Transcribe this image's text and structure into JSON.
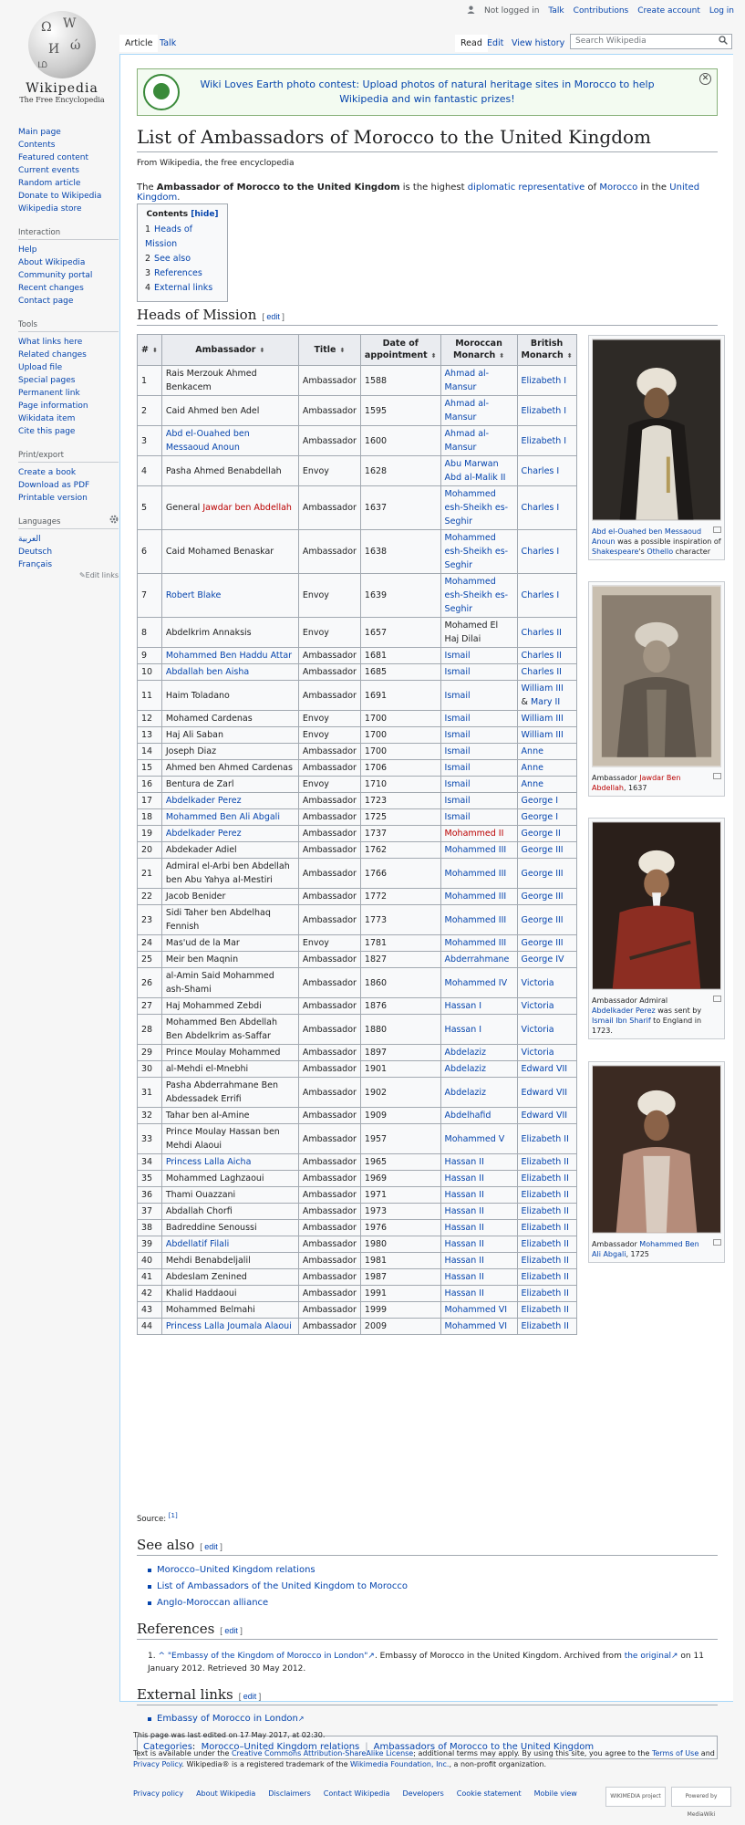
{
  "personal": {
    "not_logged_in": "Not logged in",
    "talk": "Talk",
    "contributions": "Contributions",
    "create_account": "Create account",
    "log_in": "Log in"
  },
  "logo": {
    "wordmark": "Wikipedia",
    "tagline": "The Free Encyclopedia"
  },
  "nav_main": [
    "Main page",
    "Contents",
    "Featured content",
    "Current events",
    "Random article",
    "Donate to Wikipedia",
    "Wikipedia store"
  ],
  "interaction": {
    "heading": "Interaction",
    "items": [
      "Help",
      "About Wikipedia",
      "Community portal",
      "Recent changes",
      "Contact page"
    ]
  },
  "tools": {
    "heading": "Tools",
    "items": [
      "What links here",
      "Related changes",
      "Upload file",
      "Special pages",
      "Permanent link",
      "Page information",
      "Wikidata item",
      "Cite this page"
    ]
  },
  "printexport": {
    "heading": "Print/export",
    "items": [
      "Create a book",
      "Download as PDF",
      "Printable version"
    ]
  },
  "languages": {
    "heading": "Languages",
    "items": [
      "العربية",
      "Deutsch",
      "Français"
    ],
    "edit_links": "Edit links"
  },
  "tabs": {
    "article": "Article",
    "talk": "Talk",
    "read": "Read",
    "edit": "Edit",
    "history": "View history"
  },
  "search": {
    "placeholder": "Search Wikipedia"
  },
  "banner": {
    "text": "Wiki Loves Earth photo contest: Upload photos of natural heritage sites in Morocco to help Wikipedia and win fantastic prizes!"
  },
  "article": {
    "title": "List of Ambassadors of Morocco to the United Kingdom",
    "from": "From Wikipedia, the free encyclopedia",
    "lead": {
      "p1": "The ",
      "bold": "Ambassador of Morocco to the United Kingdom",
      "p2": " is the highest ",
      "l1": "diplomatic representative",
      "p3": " of ",
      "l2": "Morocco",
      "p4": " in the ",
      "l3": "United Kingdom",
      "p5": "."
    }
  },
  "toc": {
    "title": "Contents",
    "hide": "[hide]",
    "items": [
      {
        "n": "1",
        "t": "Heads of Mission"
      },
      {
        "n": "2",
        "t": "See also"
      },
      {
        "n": "3",
        "t": "References"
      },
      {
        "n": "4",
        "t": "External links"
      }
    ]
  },
  "sections": {
    "heads": "Heads of Mission",
    "see_also": "See also",
    "references": "References",
    "external": "External links",
    "edit": "edit"
  },
  "table": {
    "headers": [
      "#",
      "Ambassador",
      "Title",
      "Date of appointment",
      "Moroccan Monarch",
      "British Monarch"
    ],
    "rows": [
      [
        "1",
        "Rais Merzouk Ahmed Benkacem",
        "Ambassador",
        "1588",
        "Ahmad al-Mansur",
        "Elizabeth I"
      ],
      [
        "2",
        "Caid Ahmed ben Adel",
        "Ambassador",
        "1595",
        "Ahmad al-Mansur",
        "Elizabeth I"
      ],
      [
        "3",
        "Abd el-Ouahed ben Messaoud Anoun",
        "Ambassador",
        "1600",
        "Ahmad al-Mansur",
        "Elizabeth I"
      ],
      [
        "4",
        "Pasha Ahmed Benabdellah",
        "Envoy",
        "1628",
        "Abu Marwan Abd al-Malik II",
        "Charles I"
      ],
      [
        "5",
        "General Jawdar ben Abdellah",
        "Ambassador",
        "1637",
        "Mohammed esh-Sheikh es-Seghir",
        "Charles I"
      ],
      [
        "6",
        "Caid Mohamed Benaskar",
        "Ambassador",
        "1638",
        "Mohammed esh-Sheikh es-Seghir",
        "Charles I"
      ],
      [
        "7",
        "Robert Blake",
        "Envoy",
        "1639",
        "Mohammed esh-Sheikh es-Seghir",
        "Charles I"
      ],
      [
        "8",
        "Abdelkrim Annaksis",
        "Envoy",
        "1657",
        "Mohamed El Haj Dilai",
        "Charles II"
      ],
      [
        "9",
        "Mohammed Ben Haddu Attar",
        "Ambassador",
        "1681",
        "Ismail",
        "Charles II"
      ],
      [
        "10",
        "Abdallah ben Aisha",
        "Ambassador",
        "1685",
        "Ismail",
        "Charles II"
      ],
      [
        "11",
        "Haim Toladano",
        "Ambassador",
        "1691",
        "Ismail",
        "William III & Mary II"
      ],
      [
        "12",
        "Mohamed Cardenas",
        "Envoy",
        "1700",
        "Ismail",
        "William III"
      ],
      [
        "13",
        "Haj Ali Saban",
        "Envoy",
        "1700",
        "Ismail",
        "William III"
      ],
      [
        "14",
        "Joseph Diaz",
        "Ambassador",
        "1700",
        "Ismail",
        "Anne"
      ],
      [
        "15",
        "Ahmed ben Ahmed Cardenas",
        "Ambassador",
        "1706",
        "Ismail",
        "Anne"
      ],
      [
        "16",
        "Bentura de Zarl",
        "Envoy",
        "1710",
        "Ismail",
        "Anne"
      ],
      [
        "17",
        "Abdelkader Perez",
        "Ambassador",
        "1723",
        "Ismail",
        "George I"
      ],
      [
        "18",
        "Mohammed Ben Ali Abgali",
        "Ambassador",
        "1725",
        "Ismail",
        "George I"
      ],
      [
        "19",
        "Abdelkader Perez",
        "Ambassador",
        "1737",
        "Mohammed II",
        "George II"
      ],
      [
        "20",
        "Abdekader Adiel",
        "Ambassador",
        "1762",
        "Mohammed III",
        "George III"
      ],
      [
        "21",
        "Admiral el-Arbi ben Abdellah ben Abu Yahya al-Mestiri",
        "Ambassador",
        "1766",
        "Mohammed III",
        "George III"
      ],
      [
        "22",
        "Jacob Benider",
        "Ambassador",
        "1772",
        "Mohammed III",
        "George III"
      ],
      [
        "23",
        "Sidi Taher ben Abdelhaq Fennish",
        "Ambassador",
        "1773",
        "Mohammed III",
        "George III"
      ],
      [
        "24",
        "Mas'ud de la Mar",
        "Envoy",
        "1781",
        "Mohammed III",
        "George III"
      ],
      [
        "25",
        "Meir ben Maqnin",
        "Ambassador",
        "1827",
        "Abderrahmane",
        "George IV"
      ],
      [
        "26",
        "al-Amin Said Mohammed ash-Shami",
        "Ambassador",
        "1860",
        "Mohammed IV",
        "Victoria"
      ],
      [
        "27",
        "Haj Mohammed Zebdi",
        "Ambassador",
        "1876",
        "Hassan I",
        "Victoria"
      ],
      [
        "28",
        "Mohammed Ben Abdellah Ben Abdelkrim as-Saffar",
        "Ambassador",
        "1880",
        "Hassan I",
        "Victoria"
      ],
      [
        "29",
        "Prince Moulay Mohammed",
        "Ambassador",
        "1897",
        "Abdelaziz",
        "Victoria"
      ],
      [
        "30",
        "al-Mehdi el-Mnebhi",
        "Ambassador",
        "1901",
        "Abdelaziz",
        "Edward VII"
      ],
      [
        "31",
        "Pasha Abderrahmane Ben Abdessadek Errifi",
        "Ambassador",
        "1902",
        "Abdelaziz",
        "Edward VII"
      ],
      [
        "32",
        "Tahar ben al-Amine",
        "Ambassador",
        "1909",
        "Abdelhafid",
        "Edward VII"
      ],
      [
        "33",
        "Prince Moulay Hassan ben Mehdi Alaoui",
        "Ambassador",
        "1957",
        "Mohammed V",
        "Elizabeth II"
      ],
      [
        "34",
        "Princess Lalla Aicha",
        "Ambassador",
        "1965",
        "Hassan II",
        "Elizabeth II"
      ],
      [
        "35",
        "Mohammed Laghzaoui",
        "Ambassador",
        "1969",
        "Hassan II",
        "Elizabeth II"
      ],
      [
        "36",
        "Thami Ouazzani",
        "Ambassador",
        "1971",
        "Hassan II",
        "Elizabeth II"
      ],
      [
        "37",
        "Abdallah Chorfi",
        "Ambassador",
        "1973",
        "Hassan II",
        "Elizabeth II"
      ],
      [
        "38",
        "Badreddine Senoussi",
        "Ambassador",
        "1976",
        "Hassan II",
        "Elizabeth II"
      ],
      [
        "39",
        "Abdellatif Filali",
        "Ambassador",
        "1980",
        "Hassan II",
        "Elizabeth II"
      ],
      [
        "40",
        "Mehdi Benabdeljalil",
        "Ambassador",
        "1981",
        "Hassan II",
        "Elizabeth II"
      ],
      [
        "41",
        "Abdeslam Zenined",
        "Ambassador",
        "1987",
        "Hassan II",
        "Elizabeth II"
      ],
      [
        "42",
        "Khalid Haddaoui",
        "Ambassador",
        "1991",
        "Hassan II",
        "Elizabeth II"
      ],
      [
        "43",
        "Mohammed Belmahi",
        "Ambassador",
        "1999",
        "Mohammed VI",
        "Elizabeth II"
      ],
      [
        "44",
        "Princess Lalla Joumala Alaoui",
        "Ambassador",
        "2009",
        "Mohammed VI",
        "Elizabeth II"
      ]
    ],
    "source_label": "Source: ",
    "source_ref": "[1]"
  },
  "figures": [
    {
      "caption_a": "Abd el-Ouahed ben Messaoud Anoun",
      "caption_b": " was a possible inspiration of ",
      "caption_c": "Shakespeare",
      "caption_d": "'s ",
      "caption_e": "Othello",
      "caption_f": " character"
    },
    {
      "caption_a": "Ambassador ",
      "caption_b": "Jawdar Ben Abdellah",
      "caption_c": ", 1637"
    },
    {
      "caption_a": "Ambassador Admiral ",
      "caption_b": "Abdelkader Perez",
      "caption_c": " was sent by ",
      "caption_d": "Ismail Ibn Sharif",
      "caption_e": " to England in 1723."
    },
    {
      "caption_a": "Ambassador ",
      "caption_b": "Mohammed Ben Ali Abgali",
      "caption_c": ", 1725"
    }
  ],
  "see_also": [
    "Morocco–United Kingdom relations",
    "List of Ambassadors of the United Kingdom to Morocco",
    "Anglo-Moroccan alliance"
  ],
  "reference": {
    "n": "1.",
    "caret": "^",
    "title": "\"Embassy of the Kingdom of Morocco in London\"",
    "t1": ". Embassy of Morocco in the United Kingdom. Archived from ",
    "orig": "the original",
    "t2": " on 11 January 2012. Retrieved 30 May 2012."
  },
  "external_links": [
    "Embassy of Morocco in London"
  ],
  "categories": {
    "label": "Categories",
    "items": [
      "Morocco–United Kingdom relations",
      "Ambassadors of Morocco to the United Kingdom"
    ]
  },
  "footer": {
    "last_edited": "This page was last edited on 17 May 2017, at 02:30.",
    "license_1": "Text is available under the ",
    "license_link": "Creative Commons Attribution-ShareAlike License",
    "license_2": "; additional terms may apply. By using this site, you agree to the ",
    "terms": "Terms of Use",
    "and": " and ",
    "privacy": "Privacy Policy",
    "license_3": ". Wikipedia® is a registered trademark of the ",
    "foundation": "Wikimedia Foundation, Inc.",
    "license_4": ", a non-profit organization.",
    "links": [
      "Privacy policy",
      "About Wikipedia",
      "Disclaimers",
      "Contact Wikipedia",
      "Developers",
      "Cookie statement",
      "Mobile view"
    ],
    "badge1": "WIKIMEDIA project",
    "badge2": "Powered by MediaWiki"
  },
  "colors": {
    "link": "#0645ad",
    "redlink": "#ba0000",
    "banner_border": "#88b17a"
  }
}
